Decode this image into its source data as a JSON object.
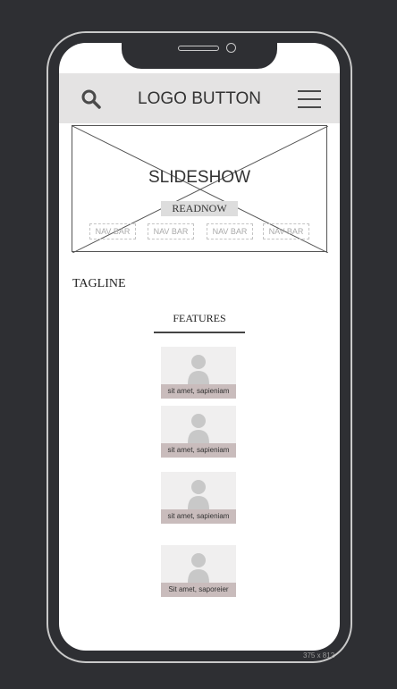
{
  "header": {
    "logo_label": "LOGO BUTTON",
    "search_icon": "search-icon",
    "menu_icon": "hamburger-menu-icon"
  },
  "slideshow": {
    "title": "SLIDESHOW",
    "cta_label": "READNOW",
    "nav_items": [
      "NAV BAR",
      "NAV BAR",
      "NAV BAR",
      "NAV BAR"
    ]
  },
  "tagline": "TAGLINE",
  "features": {
    "heading": "FEATURES",
    "cards": [
      {
        "caption": "sit amet, sapieniam",
        "icon": "user-placeholder-icon"
      },
      {
        "caption": "sit amet, sapieniam",
        "icon": "user-placeholder-icon"
      },
      {
        "caption": "sit amet, sapieniam",
        "icon": "user-placeholder-icon"
      },
      {
        "caption": "Sit amet, saporeier",
        "icon": "user-placeholder-icon"
      }
    ]
  },
  "device_size_label": "375 x 812",
  "colors": {
    "background": "#2e2f33",
    "header": "#e4e3e3",
    "caption_bg": "#c9bcbc"
  }
}
